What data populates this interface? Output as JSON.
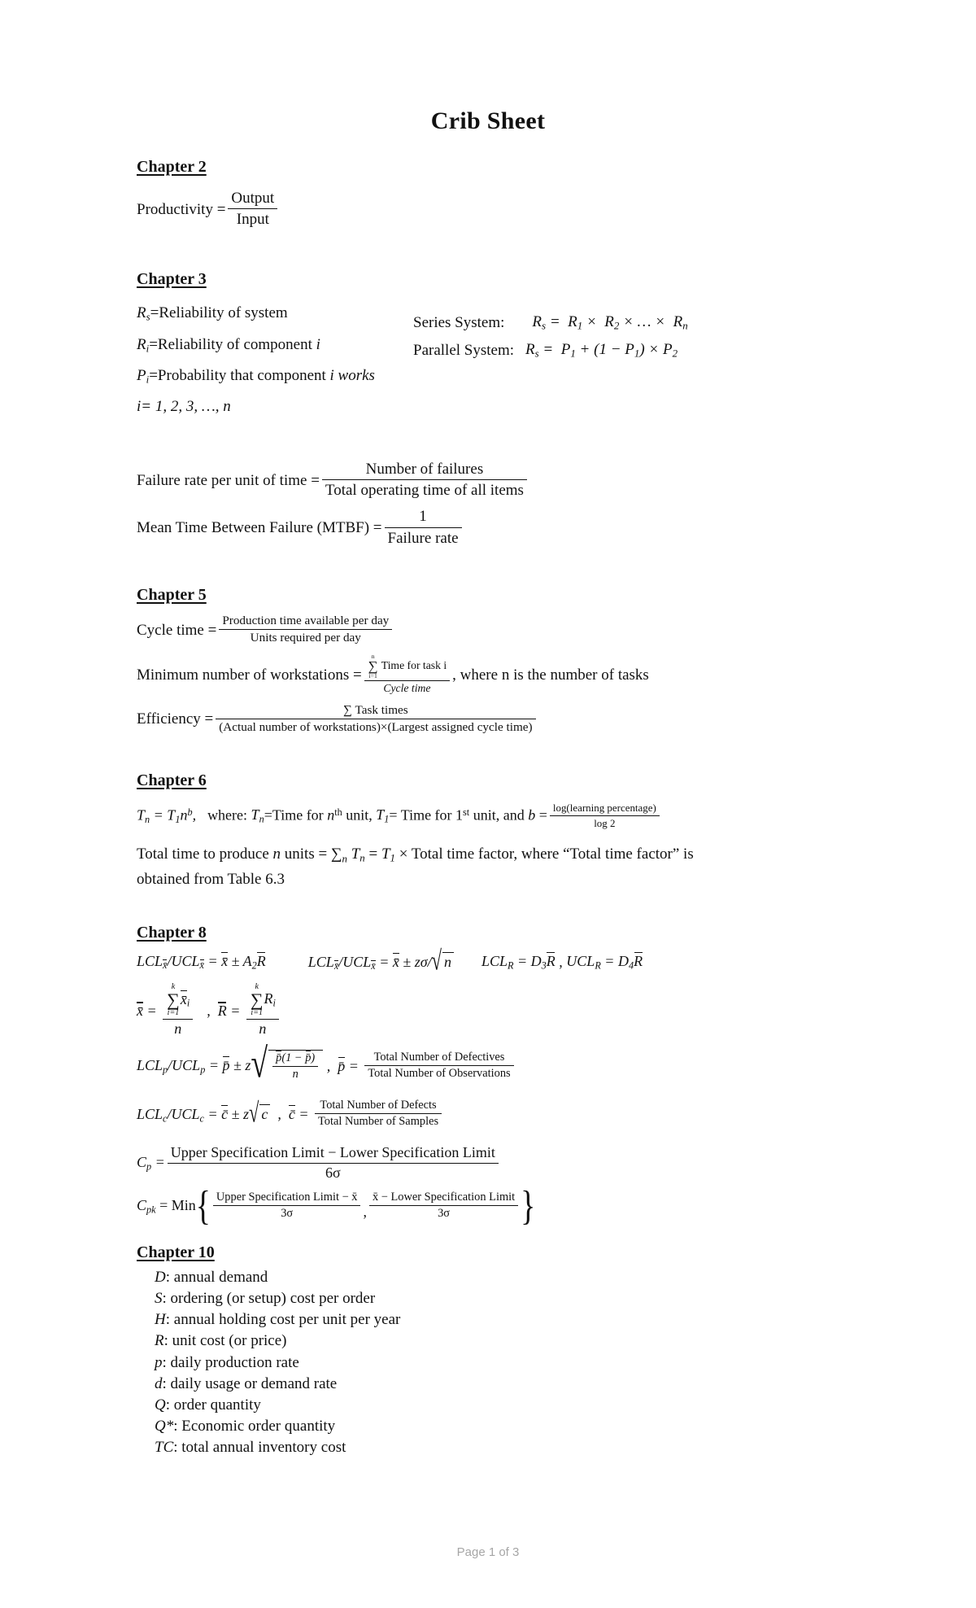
{
  "document": {
    "title": "Crib Sheet",
    "footer": "Page 1 of 3"
  },
  "chapters": {
    "ch2": {
      "heading": "Chapter 2",
      "productivity_label": "Productivity =",
      "productivity_num": "Output",
      "productivity_den": "Input"
    },
    "ch3": {
      "heading": "Chapter 3",
      "def_rs": "=Reliability of system",
      "def_rs_sym": "R",
      "def_rs_sub": "s",
      "def_ri": "=Reliability of component",
      "def_ri_sym": "R",
      "def_ri_sub": "i",
      "def_ri_tail": "i",
      "def_pi": "=Probability that component",
      "def_pi_sym": "P",
      "def_pi_sub": "i",
      "def_pi_tail": "i works",
      "def_index": "i= 1, 2, 3, …, n",
      "series_label": "Series System:",
      "series_formula": "R_s = R_1 × R_2 × … × R_n",
      "parallel_label": "Parallel System:",
      "parallel_formula": "R_s = P_1 + (1 − P_1) × P_2",
      "failure_rate_label": "Failure rate per unit of time =",
      "failure_rate_num": "Number of failures",
      "failure_rate_den": "Total operating time of all items",
      "mtbf_label": "Mean Time Between Failure (MTBF) =",
      "mtbf_num": "1",
      "mtbf_den": "Failure rate"
    },
    "ch5": {
      "heading": "Chapter 5",
      "cycle_label": "Cycle time =",
      "cycle_num": "Production time available per day",
      "cycle_den": "Units required per day",
      "minws_label": "Minimum number of workstations =",
      "minws_num": "Time for task i",
      "minws_den": "Cycle time",
      "minws_sum_top": "n",
      "minws_sum_bottom": "i=1",
      "minws_tail": ", where n is the number of tasks",
      "eff_label": "Efficiency =",
      "eff_num": "∑ Task times",
      "eff_den": "(Actual number of workstations)×(Largest assigned cycle time)"
    },
    "ch6": {
      "heading": "Chapter 6",
      "learning_formula": "T_n = T_1 n^b,",
      "where_text": "where: T_n=Time for n^th unit, T_1= Time for 1^st unit, and b =",
      "b_num": "log(learning percentage)",
      "b_den": "log 2",
      "total_time_line": "Total time to produce n units = ∑_n T_n = T_1 × Total time factor, where “Total time factor” is",
      "total_time_line2": "obtained from Table 6.3"
    },
    "ch8": {
      "heading": "Chapter 8",
      "xbar_a2_formula": "LCL_x̄/UCL_x̄ = x̄̄ ± A_2 R̄",
      "xbar_z_formula": "LCL_x̄/UCL_x̄ = x̄̄ ± zσ/√n",
      "lcl_r_formula": "LCL_R = D_3 R̄",
      "ucl_r_formula": "UCL_R = D_4 R̄",
      "xbarbar_num": "x̄_i",
      "xbarbar_den": "n",
      "rbar_num": "R_i",
      "rbar_den": "n",
      "sum_top": "k",
      "sum_bottom": "i=1",
      "p_chart_formula": "LCL_p/UCL_p = p̄ ± z",
      "p_radicand_num": "p̄(1 − p̄)",
      "p_radicand_den": "n",
      "pbar_label": "p̄ =",
      "pbar_num": "Total Number of Defectives",
      "pbar_den": "Total Number of Observations",
      "c_chart_formula": "LCL_c/UCL_c = c̄ ± z√c",
      "cbar_label": "c̄ =",
      "cbar_num": "Total Number of Defects",
      "cbar_den": "Total Number of Samples",
      "cp_label": "C_p =",
      "cp_num": "Upper Specification Limit − Lower Specification Limit",
      "cp_den": "6σ",
      "cpk_label": "C_pk = Min",
      "cpk_num1": "Upper Specification Limit − x̄",
      "cpk_den1": "3σ",
      "cpk_num2": "x̄ − Lower Specification Limit",
      "cpk_den2": "3σ"
    },
    "ch10": {
      "heading": "Chapter 10",
      "variables": [
        {
          "symbol": "D",
          "desc": ": annual demand"
        },
        {
          "symbol": "S",
          "desc": ": ordering (or setup) cost per order"
        },
        {
          "symbol": "H",
          "desc": ": annual holding cost per unit per year"
        },
        {
          "symbol": "R",
          "desc": ": unit cost (or price)"
        },
        {
          "symbol": "p",
          "desc": ": daily production rate"
        },
        {
          "symbol": "d",
          "desc": ": daily usage or demand rate"
        },
        {
          "symbol": "Q",
          "desc": ": order quantity"
        },
        {
          "symbol": "Q*",
          "desc": ": Economic order quantity"
        },
        {
          "symbol": "TC",
          "desc": ": total annual inventory cost"
        }
      ]
    }
  }
}
